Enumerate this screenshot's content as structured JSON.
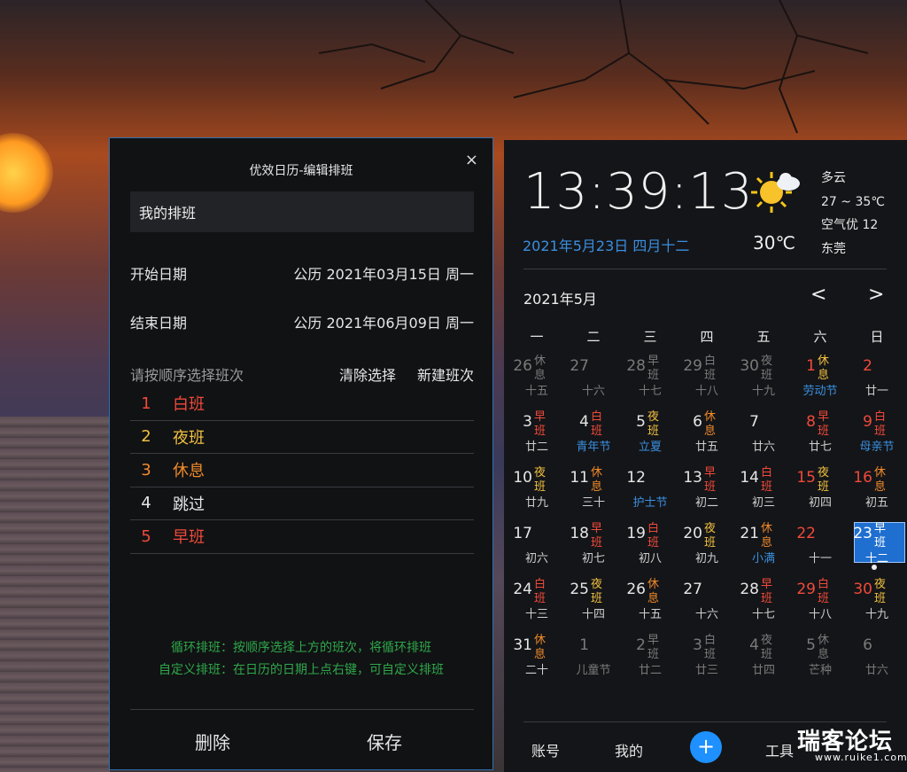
{
  "dialog": {
    "title": "优效日历-编辑排班",
    "close_icon": "×",
    "schedule_name": "我的排班",
    "start_label": "开始日期",
    "start_value": "公历 2021年03月15日 周一",
    "end_label": "结束日期",
    "end_value": "公历 2021年06月09日 周一",
    "choose_hint": "请按顺序选择班次",
    "clear_label": "清除选择",
    "new_label": "新建班次",
    "shifts": [
      {
        "num": "1",
        "name": "白班",
        "color": "#f04a3a"
      },
      {
        "num": "2",
        "name": "夜班",
        "color": "#f0c040"
      },
      {
        "num": "3",
        "name": "休息",
        "color": "#f08a2a"
      },
      {
        "num": "4",
        "name": "跳过",
        "color": "#e6e6e6"
      },
      {
        "num": "5",
        "name": "早班",
        "color": "#f04a3a"
      }
    ],
    "note1": "循环排班：按顺序选择上方的班次，将循环排班",
    "note2": "自定义排班：在日历的日期上点右键，可自定义排班",
    "delete_label": "删除",
    "save_label": "保存"
  },
  "calendar": {
    "clock": "13:39:13",
    "date": "2021年5月23日 四月十二",
    "temp": "30℃",
    "weather": "多云",
    "range": "27 ~ 35℃",
    "air": "空气优 12",
    "city": "东莞",
    "month": "2021年5月",
    "prev": "<",
    "next": ">",
    "weekdays": [
      "一",
      "二",
      "三",
      "四",
      "五",
      "六",
      "日"
    ],
    "days": [
      {
        "d": "26",
        "b": "休息",
        "s": "十五",
        "dc": "#7a7a7a",
        "bc": "#7a7a7a",
        "sc": "#7a7a7a"
      },
      {
        "d": "27",
        "b": "",
        "s": "十六",
        "dc": "#7a7a7a",
        "bc": "#7a7a7a",
        "sc": "#7a7a7a"
      },
      {
        "d": "28",
        "b": "早班",
        "s": "十七",
        "dc": "#7a7a7a",
        "bc": "#7a7a7a",
        "sc": "#7a7a7a"
      },
      {
        "d": "29",
        "b": "白班",
        "s": "十八",
        "dc": "#7a7a7a",
        "bc": "#7a7a7a",
        "sc": "#7a7a7a"
      },
      {
        "d": "30",
        "b": "夜班",
        "s": "十九",
        "dc": "#7a7a7a",
        "bc": "#7a7a7a",
        "sc": "#7a7a7a"
      },
      {
        "d": "1",
        "b": "休息",
        "s": "劳动节",
        "dc": "#f04a3a",
        "bc": "#f0c040",
        "sc": "#3a8fe0"
      },
      {
        "d": "2",
        "b": "",
        "s": "廿一",
        "dc": "#f04a3a",
        "bc": "#f04a3a",
        "sc": "#cfcfcf"
      },
      {
        "d": "3",
        "b": "早班",
        "s": "廿二",
        "dc": "#e6e6e6",
        "bc": "#f04a3a",
        "sc": "#cfcfcf"
      },
      {
        "d": "4",
        "b": "白班",
        "s": "青年节",
        "dc": "#e6e6e6",
        "bc": "#f04a3a",
        "sc": "#3a8fe0"
      },
      {
        "d": "5",
        "b": "夜班",
        "s": "立夏",
        "dc": "#e6e6e6",
        "bc": "#f0c040",
        "sc": "#3a8fe0"
      },
      {
        "d": "6",
        "b": "休息",
        "s": "廿五",
        "dc": "#e6e6e6",
        "bc": "#f08a2a",
        "sc": "#cfcfcf"
      },
      {
        "d": "7",
        "b": "",
        "s": "廿六",
        "dc": "#e6e6e6",
        "bc": "#e6e6e6",
        "sc": "#cfcfcf"
      },
      {
        "d": "8",
        "b": "早班",
        "s": "廿七",
        "dc": "#f04a3a",
        "bc": "#f04a3a",
        "sc": "#cfcfcf"
      },
      {
        "d": "9",
        "b": "白班",
        "s": "母亲节",
        "dc": "#f04a3a",
        "bc": "#f04a3a",
        "sc": "#3a8fe0"
      },
      {
        "d": "10",
        "b": "夜班",
        "s": "廿九",
        "dc": "#e6e6e6",
        "bc": "#f0c040",
        "sc": "#cfcfcf"
      },
      {
        "d": "11",
        "b": "休息",
        "s": "三十",
        "dc": "#e6e6e6",
        "bc": "#f08a2a",
        "sc": "#cfcfcf"
      },
      {
        "d": "12",
        "b": "",
        "s": "护士节",
        "dc": "#e6e6e6",
        "bc": "#e6e6e6",
        "sc": "#3a8fe0"
      },
      {
        "d": "13",
        "b": "早班",
        "s": "初二",
        "dc": "#e6e6e6",
        "bc": "#f04a3a",
        "sc": "#cfcfcf"
      },
      {
        "d": "14",
        "b": "白班",
        "s": "初三",
        "dc": "#e6e6e6",
        "bc": "#f04a3a",
        "sc": "#cfcfcf"
      },
      {
        "d": "15",
        "b": "夜班",
        "s": "初四",
        "dc": "#f04a3a",
        "bc": "#f0c040",
        "sc": "#cfcfcf"
      },
      {
        "d": "16",
        "b": "休息",
        "s": "初五",
        "dc": "#f04a3a",
        "bc": "#f08a2a",
        "sc": "#cfcfcf"
      },
      {
        "d": "17",
        "b": "",
        "s": "初六",
        "dc": "#e6e6e6",
        "bc": "#e6e6e6",
        "sc": "#cfcfcf"
      },
      {
        "d": "18",
        "b": "早班",
        "s": "初七",
        "dc": "#e6e6e6",
        "bc": "#f04a3a",
        "sc": "#cfcfcf"
      },
      {
        "d": "19",
        "b": "白班",
        "s": "初八",
        "dc": "#e6e6e6",
        "bc": "#f04a3a",
        "sc": "#cfcfcf"
      },
      {
        "d": "20",
        "b": "夜班",
        "s": "初九",
        "dc": "#e6e6e6",
        "bc": "#f0c040",
        "sc": "#cfcfcf"
      },
      {
        "d": "21",
        "b": "休息",
        "s": "小满",
        "dc": "#e6e6e6",
        "bc": "#f08a2a",
        "sc": "#3a8fe0"
      },
      {
        "d": "22",
        "b": "",
        "s": "十一",
        "dc": "#f04a3a",
        "bc": "#f04a3a",
        "sc": "#cfcfcf"
      },
      {
        "d": "23",
        "b": "早班",
        "s": "十二",
        "dc": "#ffffff",
        "bc": "#ffffff",
        "sc": "#ffffff",
        "sel": true
      },
      {
        "d": "24",
        "b": "白班",
        "s": "十三",
        "dc": "#e6e6e6",
        "bc": "#f04a3a",
        "sc": "#cfcfcf"
      },
      {
        "d": "25",
        "b": "夜班",
        "s": "十四",
        "dc": "#e6e6e6",
        "bc": "#f0c040",
        "sc": "#cfcfcf"
      },
      {
        "d": "26",
        "b": "休息",
        "s": "十五",
        "dc": "#e6e6e6",
        "bc": "#f08a2a",
        "sc": "#cfcfcf"
      },
      {
        "d": "27",
        "b": "",
        "s": "十六",
        "dc": "#e6e6e6",
        "bc": "#e6e6e6",
        "sc": "#cfcfcf"
      },
      {
        "d": "28",
        "b": "早班",
        "s": "十七",
        "dc": "#e6e6e6",
        "bc": "#f04a3a",
        "sc": "#cfcfcf"
      },
      {
        "d": "29",
        "b": "白班",
        "s": "十八",
        "dc": "#f04a3a",
        "bc": "#f04a3a",
        "sc": "#cfcfcf"
      },
      {
        "d": "30",
        "b": "夜班",
        "s": "十九",
        "dc": "#f04a3a",
        "bc": "#f0c040",
        "sc": "#cfcfcf"
      },
      {
        "d": "31",
        "b": "休息",
        "s": "二十",
        "dc": "#e6e6e6",
        "bc": "#f08a2a",
        "sc": "#cfcfcf"
      },
      {
        "d": "1",
        "b": "",
        "s": "儿童节",
        "dc": "#7a7a7a",
        "bc": "#7a7a7a",
        "sc": "#7a7a7a"
      },
      {
        "d": "2",
        "b": "早班",
        "s": "廿二",
        "dc": "#7a7a7a",
        "bc": "#7a7a7a",
        "sc": "#7a7a7a"
      },
      {
        "d": "3",
        "b": "白班",
        "s": "廿三",
        "dc": "#7a7a7a",
        "bc": "#7a7a7a",
        "sc": "#7a7a7a"
      },
      {
        "d": "4",
        "b": "夜班",
        "s": "廿四",
        "dc": "#7a7a7a",
        "bc": "#7a7a7a",
        "sc": "#7a7a7a"
      },
      {
        "d": "5",
        "b": "休息",
        "s": "芒种",
        "dc": "#7a7a7a",
        "bc": "#7a7a7a",
        "sc": "#7a7a7a"
      },
      {
        "d": "6",
        "b": "",
        "s": "廿六",
        "dc": "#7a7a7a",
        "bc": "#7a7a7a",
        "sc": "#7a7a7a"
      }
    ],
    "bottom": {
      "account": "账号",
      "mine": "我的",
      "plus": "+",
      "tools": "工具"
    }
  },
  "watermark": {
    "main": "瑞客论坛",
    "sub": "www.ruike1.com"
  },
  "icons": {
    "weather": "partly-cloudy-sun-icon",
    "close": "close-icon"
  }
}
